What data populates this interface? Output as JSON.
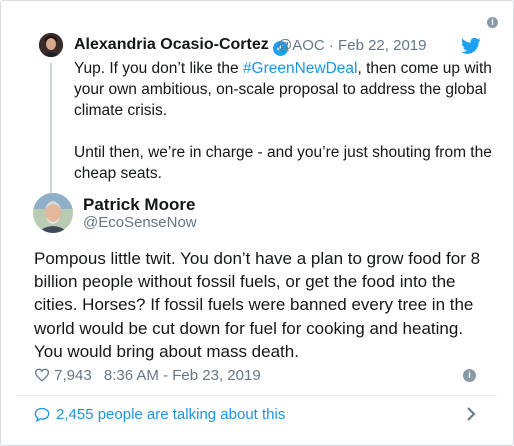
{
  "quoted_tweet": {
    "author_name": "Alexandria Ocasio-Cortez",
    "meta": "@AOC · Feb 22, 2019",
    "text_before_hashtag": "Yup. If you don’t like the ",
    "hashtag": "#GreenNewDeal",
    "text_after_hashtag": ", then come up with your own ambitious, on-scale proposal to address the global climate crisis.",
    "text_p2": "Until then, we’re in charge - and you’re just shouting from the cheap seats."
  },
  "main_tweet": {
    "author_name": "Patrick Moore",
    "handle": "@EcoSenseNow",
    "text": "Pompous little twit. You don’t have a plan to grow food for 8 billion people without fossil fuels, or get the food into the cities. Horses? If fossil fuels were banned every tree in the world would be cut down for fuel for cooking and heating. You would bring about mass death.",
    "likes": "7,943",
    "timestamp": "8:36 AM - Feb 23, 2019"
  },
  "footer": {
    "talking_text": "2,455 people are talking about this"
  },
  "icons": {
    "info": "info-icon",
    "bird": "twitter-bird-icon",
    "verified": "verified-badge-icon",
    "heart": "heart-icon",
    "bubble": "speech-bubble-icon",
    "chevron": "chevron-right-icon"
  },
  "colors": {
    "link": "#1b95e0",
    "twitter_blue": "#1da1f2",
    "muted": "#657786"
  }
}
